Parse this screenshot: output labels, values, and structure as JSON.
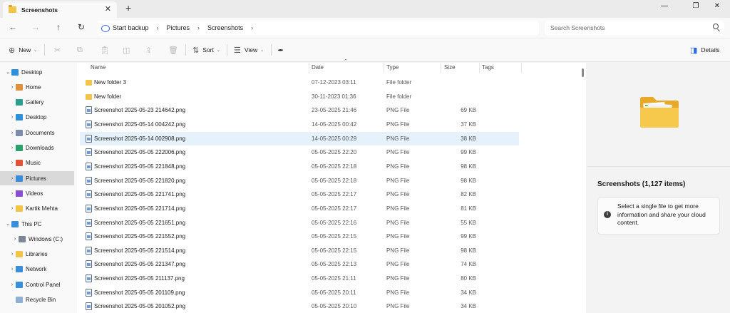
{
  "window": {
    "tab_title": "Screenshots",
    "tab_close": "✕",
    "new_tab": "+",
    "minimize": "—",
    "restore": "❐",
    "close": "✕"
  },
  "address": {
    "back": "←",
    "forward": "→",
    "up": "↑",
    "refresh": "↻",
    "start_backup": "Start backup",
    "crumbs": [
      "Pictures",
      "Screenshots"
    ],
    "separator": "›",
    "search_placeholder": "Search Screenshots"
  },
  "toolbar": {
    "new_label": "New",
    "new_icon": "⊕",
    "sort_label": "Sort",
    "sort_icon": "⇅",
    "view_label": "View",
    "view_icon": "☰",
    "more": "•••",
    "details_label": "Details",
    "chevron": "⌄"
  },
  "nav": {
    "items": [
      {
        "label": "Desktop",
        "exp": "⌄",
        "icon": "desktop-icon",
        "color": "#2f8fd8"
      },
      {
        "label": "Home",
        "exp": "›",
        "icon": "home-icon",
        "color": "#e0903a"
      },
      {
        "label": "Gallery",
        "exp": "",
        "icon": "gallery-icon",
        "color": "#2a9d8f"
      },
      {
        "label": "Desktop",
        "exp": "›",
        "icon": "desktop-icon",
        "color": "#2f8fd8"
      },
      {
        "label": "Documents",
        "exp": "›",
        "icon": "documents-icon",
        "color": "#7b8ba8"
      },
      {
        "label": "Downloads",
        "exp": "›",
        "icon": "downloads-icon",
        "color": "#2aa06b"
      },
      {
        "label": "Music",
        "exp": "›",
        "icon": "music-icon",
        "color": "#e0533a"
      },
      {
        "label": "Pictures",
        "exp": "›",
        "icon": "pictures-icon",
        "color": "#3a8ed8"
      },
      {
        "label": "Videos",
        "exp": "›",
        "icon": "videos-icon",
        "color": "#8a4fd0"
      },
      {
        "label": "Kartik Mehta",
        "exp": "›",
        "icon": "folder-icon",
        "color": "#f2c54a"
      },
      {
        "label": "This PC",
        "exp": "⌄",
        "icon": "pc-icon",
        "color": "#3a8ed8"
      },
      {
        "label": "Windows (C:)",
        "exp": "›",
        "icon": "drive-icon",
        "color": "#7c8696"
      },
      {
        "label": "Libraries",
        "exp": "›",
        "icon": "libraries-icon",
        "color": "#f2c54a"
      },
      {
        "label": "Network",
        "exp": "›",
        "icon": "network-icon",
        "color": "#3a8ed8"
      },
      {
        "label": "Control Panel",
        "exp": "›",
        "icon": "control-panel-icon",
        "color": "#3a8ed8"
      },
      {
        "label": "Recycle Bin",
        "exp": "",
        "icon": "recycle-bin-icon",
        "color": "#8fb0d0"
      }
    ]
  },
  "columns": {
    "name": "Name",
    "date": "Date",
    "type": "Type",
    "size": "Size",
    "tags": "Tags",
    "sort_arrow": "⌃"
  },
  "files": [
    {
      "name": "New folder 3",
      "date": "07-12-2023 03:11",
      "type": "File folder",
      "size": "",
      "kind": "folder"
    },
    {
      "name": "New folder",
      "date": "30-11-2023 01:36",
      "type": "File folder",
      "size": "",
      "kind": "folder"
    },
    {
      "name": "Screenshot 2025-05-23 214642.png",
      "date": "23-05-2025 21:46",
      "type": "PNG File",
      "size": "69 KB",
      "kind": "png"
    },
    {
      "name": "Screenshot 2025-05-14 004242.png",
      "date": "14-05-2025 00:42",
      "type": "PNG File",
      "size": "37 KB",
      "kind": "png"
    },
    {
      "name": "Screenshot 2025-05-14 002908.png",
      "date": "14-05-2025 00:29",
      "type": "PNG File",
      "size": "38 KB",
      "kind": "png",
      "selected": true
    },
    {
      "name": "Screenshot 2025-05-05 222006.png",
      "date": "05-05-2025 22:20",
      "type": "PNG File",
      "size": "99 KB",
      "kind": "png"
    },
    {
      "name": "Screenshot 2025-05-05 221848.png",
      "date": "05-05-2025 22:18",
      "type": "PNG File",
      "size": "98 KB",
      "kind": "png"
    },
    {
      "name": "Screenshot 2025-05-05 221820.png",
      "date": "05-05-2025 22:18",
      "type": "PNG File",
      "size": "98 KB",
      "kind": "png"
    },
    {
      "name": "Screenshot 2025-05-05 221741.png",
      "date": "05-05-2025 22:17",
      "type": "PNG File",
      "size": "82 KB",
      "kind": "png"
    },
    {
      "name": "Screenshot 2025-05-05 221714.png",
      "date": "05-05-2025 22:17",
      "type": "PNG File",
      "size": "81 KB",
      "kind": "png"
    },
    {
      "name": "Screenshot 2025-05-05 221651.png",
      "date": "05-05-2025 22:16",
      "type": "PNG File",
      "size": "55 KB",
      "kind": "png"
    },
    {
      "name": "Screenshot 2025-05-05 221552.png",
      "date": "05-05-2025 22:15",
      "type": "PNG File",
      "size": "99 KB",
      "kind": "png"
    },
    {
      "name": "Screenshot 2025-05-05 221514.png",
      "date": "05-05-2025 22:15",
      "type": "PNG File",
      "size": "98 KB",
      "kind": "png"
    },
    {
      "name": "Screenshot 2025-05-05 221347.png",
      "date": "05-05-2025 22:13",
      "type": "PNG File",
      "size": "74 KB",
      "kind": "png"
    },
    {
      "name": "Screenshot 2025-05-05 211137.png",
      "date": "05-05-2025 21:11",
      "type": "PNG File",
      "size": "80 KB",
      "kind": "png"
    },
    {
      "name": "Screenshot 2025-05-05 201109.png",
      "date": "05-05-2025 20:11",
      "type": "PNG File",
      "size": "34 KB",
      "kind": "png"
    },
    {
      "name": "Screenshot 2025-05-05 201052.png",
      "date": "05-05-2025 20:10",
      "type": "PNG File",
      "size": "34 KB",
      "kind": "png"
    }
  ],
  "details": {
    "title": "Screenshots (1,127 items)",
    "info_icon": "i",
    "info_text": "Select a single file to get more information and share your cloud content."
  },
  "colors": {
    "selection": "#e5f1fb",
    "nav_selected": "#d9d9d9",
    "accent": "#2d6ae3",
    "folder": "#f2c54a"
  }
}
